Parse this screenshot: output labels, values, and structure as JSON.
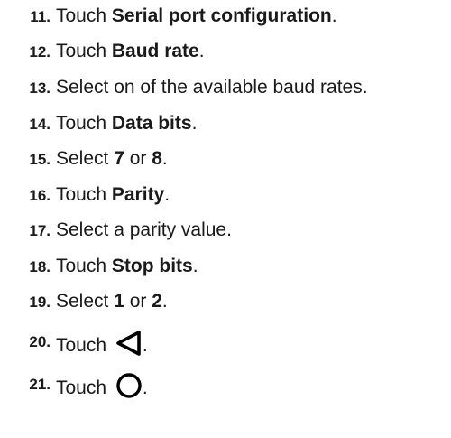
{
  "steps": [
    {
      "num": "11.",
      "pre": "Touch ",
      "bold": "Serial port configuration",
      "post": "."
    },
    {
      "num": "12.",
      "pre": "Touch ",
      "bold": "Baud rate",
      "post": "."
    },
    {
      "num": "13.",
      "text": "Select on of the available baud rates."
    },
    {
      "num": "14.",
      "pre": "Touch ",
      "bold": "Data bits",
      "post": "."
    },
    {
      "num": "15.",
      "pre": "Select ",
      "bold1": "7",
      "mid": " or ",
      "bold2": "8",
      "post": "."
    },
    {
      "num": "16.",
      "pre": "Touch ",
      "bold": "Parity",
      "post": "."
    },
    {
      "num": "17.",
      "text": "Select a parity value."
    },
    {
      "num": "18.",
      "pre": "Touch ",
      "bold": "Stop bits",
      "post": "."
    },
    {
      "num": "19.",
      "pre": "Select ",
      "bold1": "1",
      "mid": " or ",
      "bold2": "2",
      "post": "."
    },
    {
      "num": "20.",
      "pre": "Touch ",
      "icon": "back-triangle-icon",
      "post": "."
    },
    {
      "num": "21.",
      "pre": "Touch ",
      "icon": "home-circle-icon",
      "post": "."
    }
  ]
}
